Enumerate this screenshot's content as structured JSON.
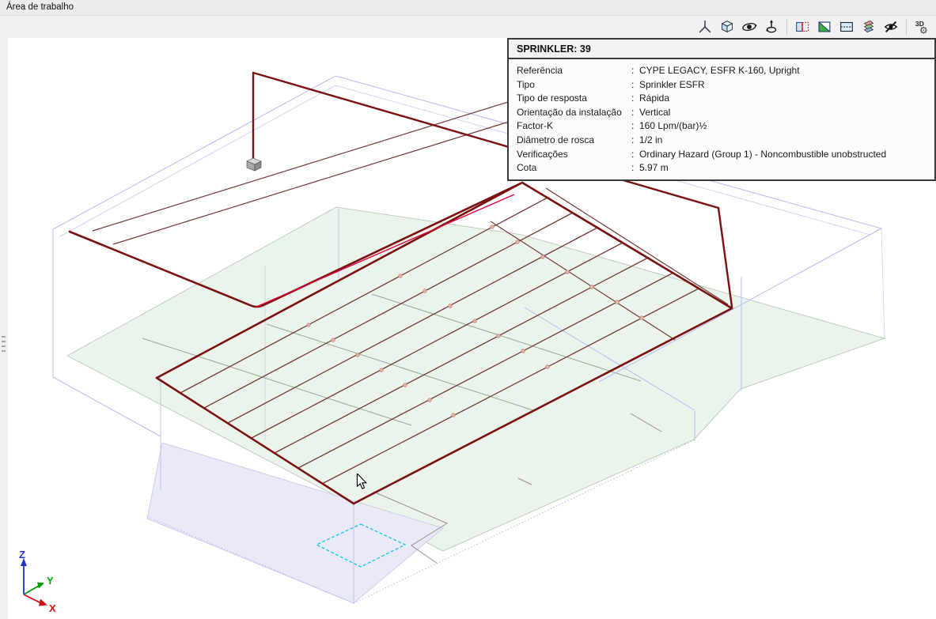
{
  "window": {
    "title": "Área de trabalho"
  },
  "toolbar": {
    "render3d_label": "3D",
    "icons": [
      {
        "name": "coordinate-axes-icon"
      },
      {
        "name": "isometric-cube-icon"
      },
      {
        "name": "orbit-view-icon"
      },
      {
        "name": "rotate-view-icon"
      },
      {
        "name": "section-plane-icon"
      },
      {
        "name": "section-diagonal-icon"
      },
      {
        "name": "clipping-box-icon"
      },
      {
        "name": "layers-icon"
      },
      {
        "name": "hide-elements-icon"
      },
      {
        "name": "render-3d-icon"
      }
    ]
  },
  "info_panel": {
    "title": "SPRINKLER: 39",
    "separator": ":",
    "rows": [
      {
        "label": "Referência",
        "value": "CYPE LEGACY, ESFR K-160, Upright"
      },
      {
        "label": "Tipo",
        "value": "Sprinkler ESFR"
      },
      {
        "label": "Tipo de resposta",
        "value": "Rápida"
      },
      {
        "label": "Orientação da instalação",
        "value": "Vertical"
      },
      {
        "label": "Factor-K",
        "value": "160 Lpm/(bar)½"
      },
      {
        "label": "Diâmetro de rosca",
        "value": "1/2 in"
      },
      {
        "label": "Verificações",
        "value": "Ordinary Hazard (Group 1) - Noncombustible unobstructed"
      },
      {
        "label": "Cota",
        "value": "5.97 m"
      }
    ]
  },
  "axes": {
    "x": "X",
    "y": "Y",
    "z": "Z"
  },
  "colors": {
    "pipe_main": "#7a1010",
    "pipe_branch": "#6e3b35",
    "pipe_highlight": "#e00040",
    "wireframe": "#b9b9f0",
    "ceiling_plane": "#e9f3e9",
    "floor_plane": "#e9e9f7",
    "selection_rect": "#00c4e0",
    "axis_x": "#cc1111",
    "axis_y": "#009a00",
    "axis_z": "#2233cc"
  }
}
